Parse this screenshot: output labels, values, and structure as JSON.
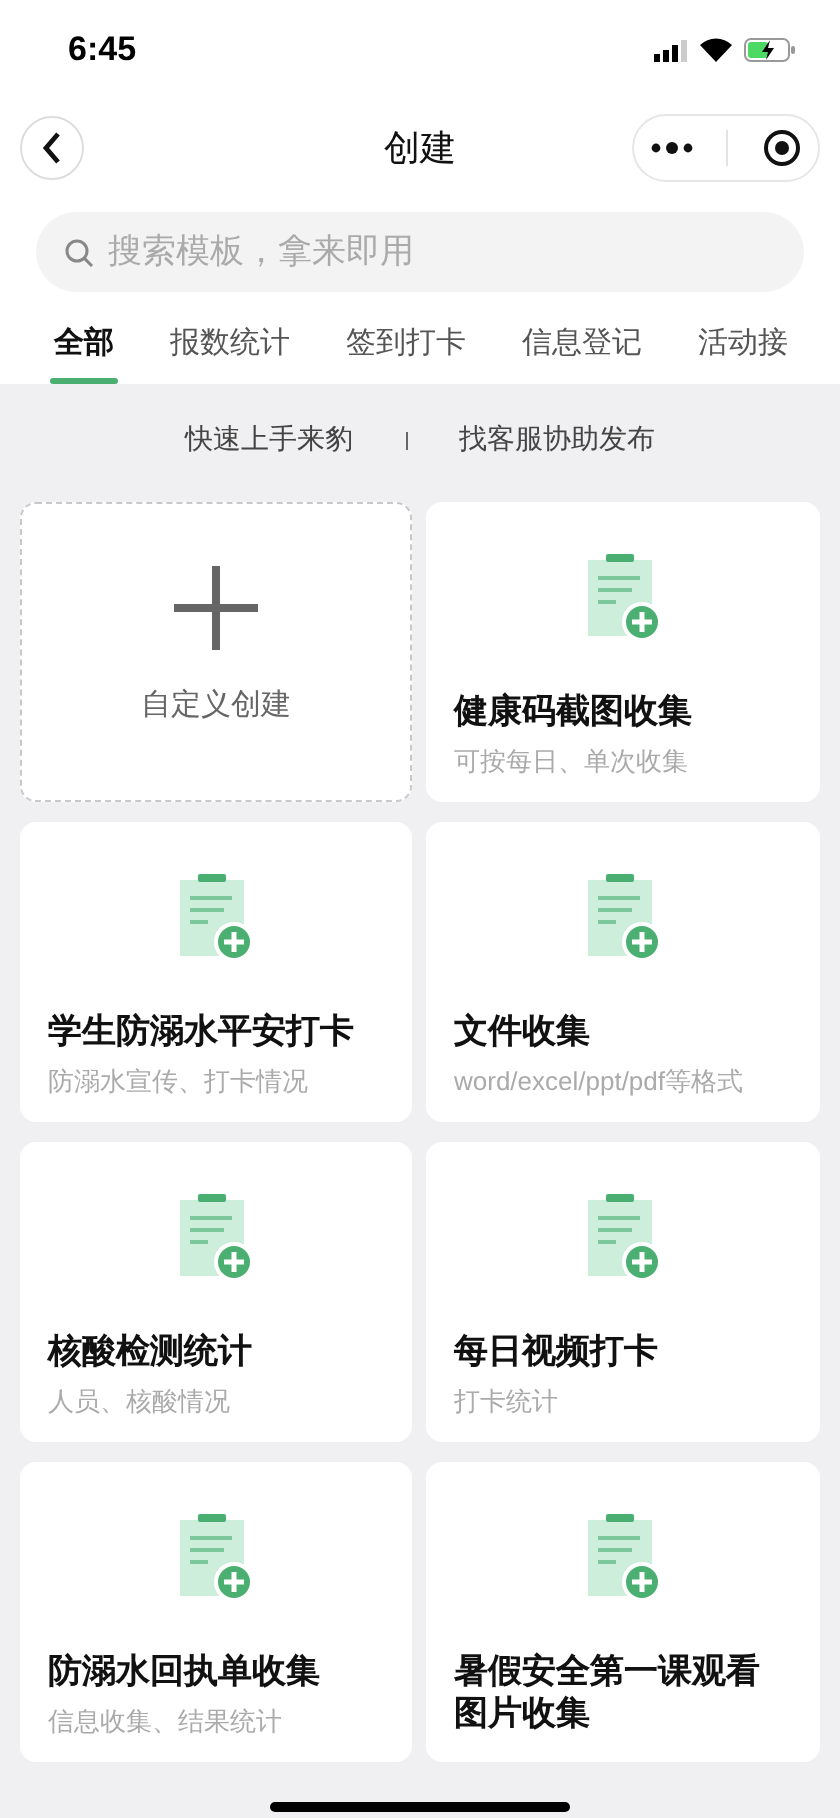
{
  "status_bar": {
    "time": "6:45"
  },
  "nav": {
    "title": "创建"
  },
  "search": {
    "placeholder": "搜索模板，拿来即用"
  },
  "tabs": [
    {
      "label": "全部",
      "selected": true
    },
    {
      "label": "报数统计",
      "selected": false
    },
    {
      "label": "签到打卡",
      "selected": false
    },
    {
      "label": "信息登记",
      "selected": false
    },
    {
      "label": "活动接",
      "selected": false
    }
  ],
  "links": [
    "快速上手来豹",
    "找客服协助发布"
  ],
  "cards": [
    {
      "kind": "custom",
      "title": "自定义创建"
    },
    {
      "kind": "template",
      "title": "健康码截图收集",
      "subtitle": "可按每日、单次收集"
    },
    {
      "kind": "template",
      "title": "学生防溺水平安打卡",
      "subtitle": "防溺水宣传、打卡情况"
    },
    {
      "kind": "template",
      "title": "文件收集",
      "subtitle": "word/excel/ppt/pdf等格式"
    },
    {
      "kind": "template",
      "title": "核酸检测统计",
      "subtitle": "人员、核酸情况"
    },
    {
      "kind": "template",
      "title": "每日视频打卡",
      "subtitle": "打卡统计"
    },
    {
      "kind": "template",
      "title": "防溺水回执单收集",
      "subtitle": "信息收集、结果统计"
    },
    {
      "kind": "template",
      "title": "暑假安全第一课观看图片收集"
    }
  ]
}
